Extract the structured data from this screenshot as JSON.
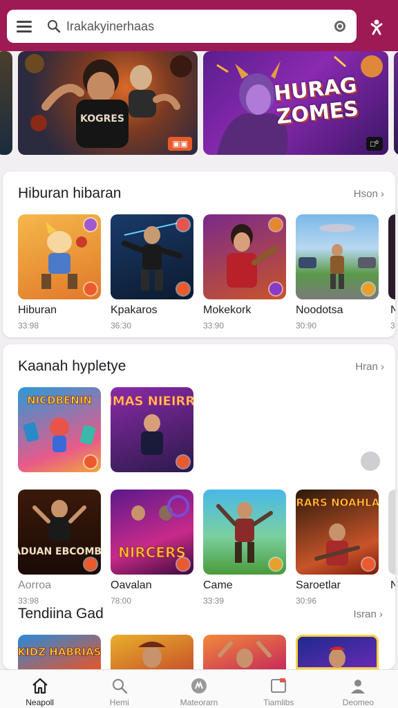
{
  "search": {
    "placeholder": "Irakakyinerhaas",
    "value": "Irakakyinerhaas"
  },
  "banners": [
    {
      "badge": ""
    },
    {
      "badge": "▣▣"
    },
    {
      "title": "HURAG ZOMES",
      "badge": "□⁰"
    }
  ],
  "sections": [
    {
      "title": "Hiburan hibaran",
      "more": "Hson",
      "tiles": [
        {
          "name": "Hiburan",
          "sub": "33:98"
        },
        {
          "name": "Kpakaros",
          "sub": "36:30"
        },
        {
          "name": "Mokekork",
          "sub": "33:90"
        },
        {
          "name": "Noodotsa",
          "sub": "30:90"
        },
        {
          "name": "N",
          "sub": "3"
        }
      ]
    },
    {
      "title": "Kaanah hypletye",
      "more": "Hran",
      "tiles_row1": [
        {
          "art": "NICDBENIN"
        },
        {
          "art": "MIMAS NIEIRRIS"
        }
      ],
      "tiles_row2": [
        {
          "name": "Aorroa",
          "sub": "33:98",
          "art": "BIADUAN EBCOMBAR"
        },
        {
          "name": "Oavalan",
          "sub": "78:00",
          "art": "NIRCERS"
        },
        {
          "name": "Came",
          "sub": "33:39"
        },
        {
          "name": "Saroetlar",
          "sub": "30:96",
          "art": "DRARS NOAHLAS"
        },
        {
          "name": "N",
          "sub": ""
        }
      ]
    }
  ],
  "trending": {
    "title": "Tendiina Gad",
    "more": "Isran",
    "art": "KIDZ HABRIAS"
  },
  "nav": [
    {
      "label": "Neapoll",
      "icon": "home-icon"
    },
    {
      "label": "Hemi",
      "icon": "search-icon"
    },
    {
      "label": "Mateorarn",
      "icon": "controller-icon"
    },
    {
      "label": "Tiamlibs",
      "icon": "library-icon"
    },
    {
      "label": "Deomeo",
      "icon": "person-icon"
    }
  ],
  "colors": {
    "topbar": "#9e1a54",
    "accent": "#ec5a2c",
    "background": "#f1eff2"
  }
}
